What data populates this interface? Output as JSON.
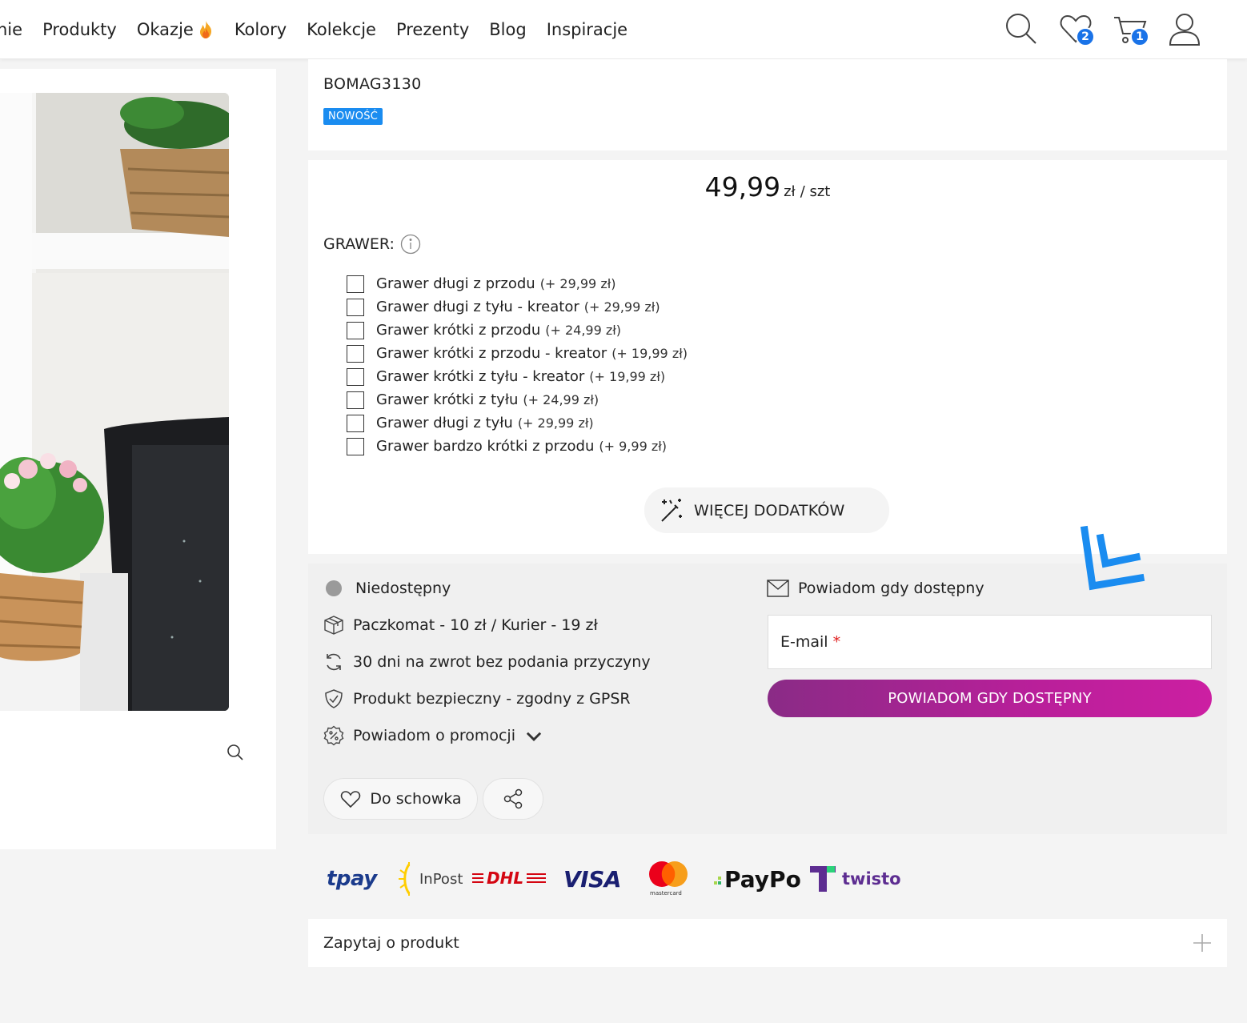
{
  "nav": {
    "items": [
      "nie",
      "Produkty",
      "Okazje",
      "Kolory",
      "Kolekcje",
      "Prezenty",
      "Blog",
      "Inspiracje"
    ],
    "wishlist_count": "2",
    "cart_count": "1",
    "icons": [
      "search-icon",
      "heart-icon",
      "cart-icon",
      "user-icon"
    ]
  },
  "product": {
    "sku": "BOMAG3130",
    "badge": "NOWOŚĆ",
    "price": "49,99",
    "currency": "zł",
    "unit": "/ szt"
  },
  "engraving": {
    "title": "GRAWER:",
    "options": [
      {
        "label": "Grawer długi z przodu",
        "price": "(+ 29,99 zł)"
      },
      {
        "label": "Grawer długi z tyłu - kreator",
        "price": "(+ 29,99 zł)"
      },
      {
        "label": "Grawer krótki z przodu",
        "price": "(+ 24,99 zł)"
      },
      {
        "label": "Grawer krótki z przodu - kreator",
        "price": "(+ 19,99 zł)"
      },
      {
        "label": "Grawer krótki z tyłu - kreator",
        "price": "(+ 19,99 zł)"
      },
      {
        "label": "Grawer krótki z tyłu",
        "price": "(+ 24,99 zł)"
      },
      {
        "label": "Grawer długi z tyłu",
        "price": "(+ 29,99 zł)"
      },
      {
        "label": "Grawer bardzo krótki z przodu",
        "price": "(+ 9,99 zł)"
      }
    ],
    "more_button": "WIĘCEJ DODATKÓW"
  },
  "info": {
    "availability": "Niedostępny",
    "shipping": "Paczkomat - 10 zł / Kurier - 19 zł",
    "returns": "30 dni na zwrot bez podania przyczyny",
    "safety": "Produkt bezpieczny - zgodny z GPSR",
    "promo": "Powiadom o promocji",
    "wishlist_button": "Do schowka"
  },
  "notify": {
    "title": "Powiadom gdy dostępny",
    "email_label": "E-mail",
    "required_mark": "*",
    "button": "POWIADOM GDY DOSTĘPNY"
  },
  "payments": {
    "tpay": "tpay",
    "inpost": "InPost",
    "dhl": "DHL",
    "visa": "VISA",
    "mastercard": "mastercard",
    "paypo": "PayPo",
    "twisto": "twisto"
  },
  "ask": {
    "label": "Zapytaj o produkt"
  },
  "colors": {
    "accent_blue": "#1a73e8",
    "new_badge": "#1a8cf0",
    "notify_button": "#b91f9a",
    "availability_dot": "#9a9a9a"
  }
}
